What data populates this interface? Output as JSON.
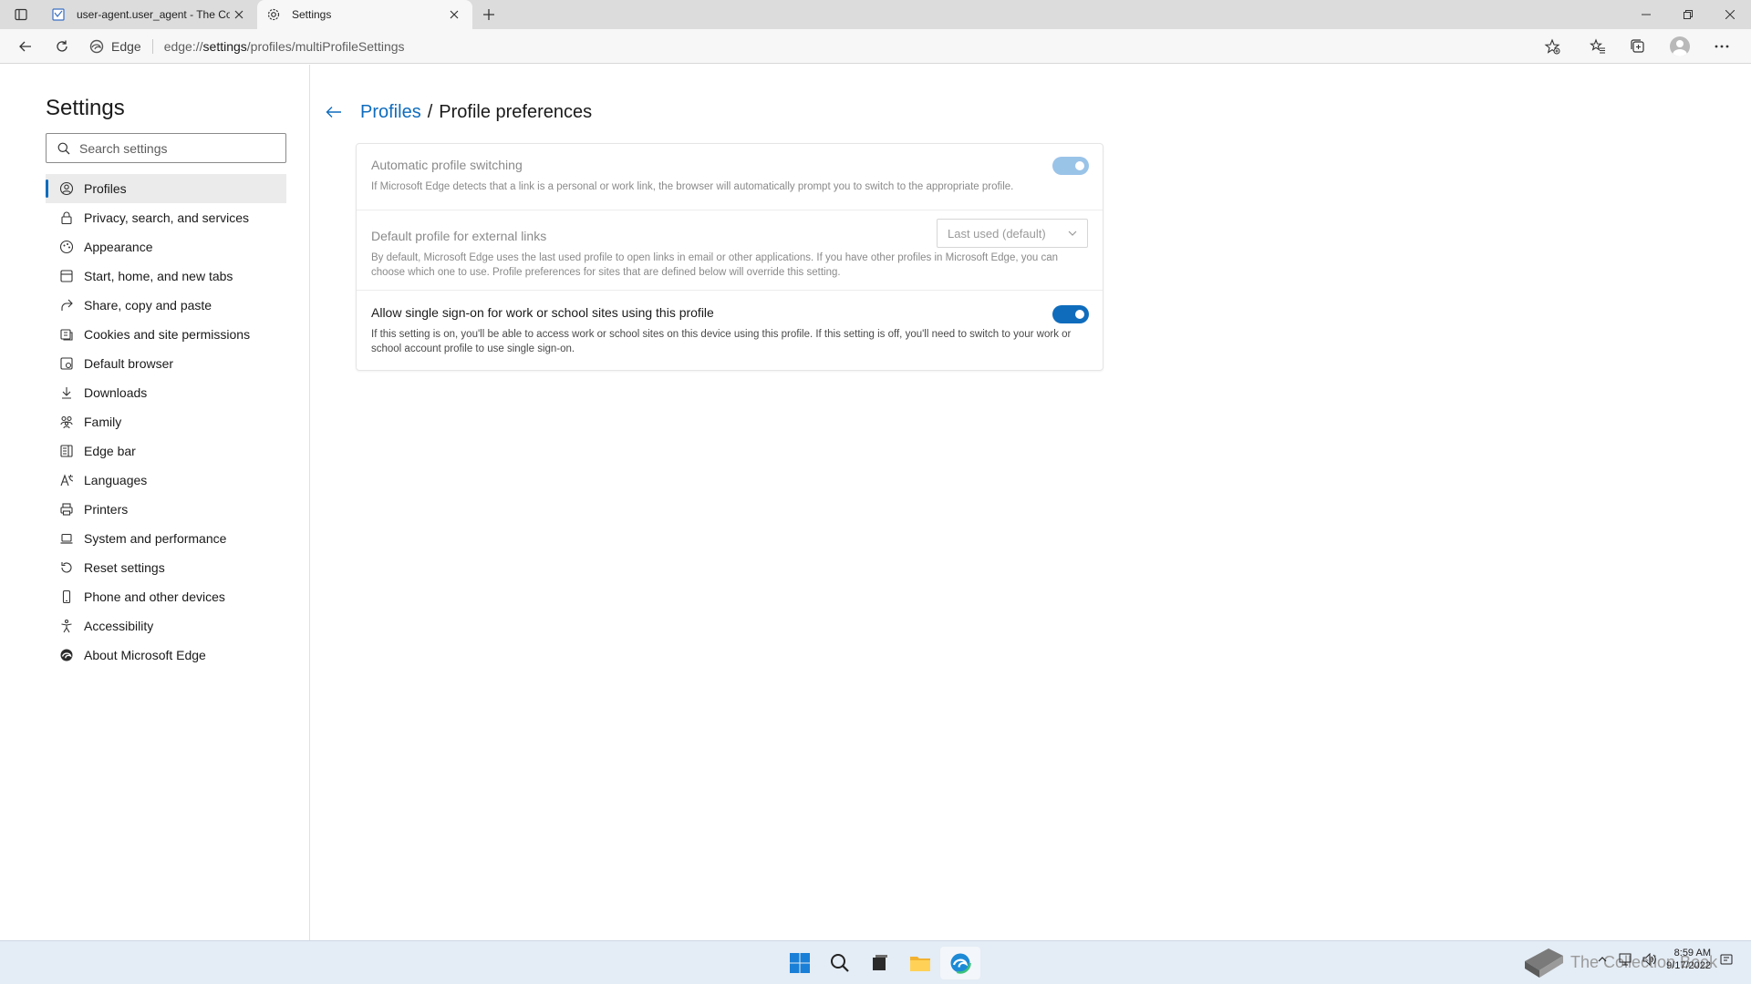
{
  "tabs": [
    {
      "title": "user-agent.user_agent - The Coll",
      "favicon": "document-icon"
    },
    {
      "title": "Settings",
      "favicon": "gear-icon"
    }
  ],
  "address": {
    "site_label": "Edge",
    "url_prefix": "edge://",
    "url_host": "settings",
    "url_path": "/profiles/multiProfileSettings"
  },
  "sidebar": {
    "title": "Settings",
    "search_placeholder": "Search settings",
    "items": [
      {
        "label": "Profiles",
        "icon": "profile-icon"
      },
      {
        "label": "Privacy, search, and services",
        "icon": "lock-icon"
      },
      {
        "label": "Appearance",
        "icon": "appearance-icon"
      },
      {
        "label": "Start, home, and new tabs",
        "icon": "start-icon"
      },
      {
        "label": "Share, copy and paste",
        "icon": "share-icon"
      },
      {
        "label": "Cookies and site permissions",
        "icon": "cookie-icon"
      },
      {
        "label": "Default browser",
        "icon": "browser-icon"
      },
      {
        "label": "Downloads",
        "icon": "download-icon"
      },
      {
        "label": "Family",
        "icon": "family-icon"
      },
      {
        "label": "Edge bar",
        "icon": "edge-bar-icon"
      },
      {
        "label": "Languages",
        "icon": "language-icon"
      },
      {
        "label": "Printers",
        "icon": "printer-icon"
      },
      {
        "label": "System and performance",
        "icon": "laptop-icon"
      },
      {
        "label": "Reset settings",
        "icon": "reset-icon"
      },
      {
        "label": "Phone and other devices",
        "icon": "phone-icon"
      },
      {
        "label": "Accessibility",
        "icon": "accessibility-icon"
      },
      {
        "label": "About Microsoft Edge",
        "icon": "edge-icon"
      }
    ]
  },
  "main": {
    "breadcrumb_link": "Profiles",
    "breadcrumb_separator": "/",
    "breadcrumb_current": "Profile preferences",
    "settings": [
      {
        "label": "Automatic profile switching",
        "description": "If Microsoft Edge detects that a link is a personal or work link, the browser will automatically prompt you to switch to the appropriate profile.",
        "enabled": true,
        "disabled_state": true
      },
      {
        "label": "Default profile for external links",
        "description": "By default, Microsoft Edge uses the last used profile to open links in email or other applications. If you have other profiles in Microsoft Edge, you can choose which one to use. Profile preferences for sites that are defined below will override this setting.",
        "select_value": "Last used (default)",
        "disabled_state": true
      },
      {
        "label": "Allow single sign-on for work or school sites using this profile",
        "description": "If this setting is on, you'll be able to access work or school sites on this device using this profile. If this setting is off, you'll need to switch to your work or school account profile to use single sign-on.",
        "enabled": true,
        "disabled_state": false
      }
    ]
  },
  "taskbar": {
    "time": "8:59 AM",
    "date": "9/17/2022",
    "watermark": "The Collection Book"
  },
  "colors": {
    "accent": "#0f6cbd",
    "taskbar": "#e4ecf5"
  }
}
